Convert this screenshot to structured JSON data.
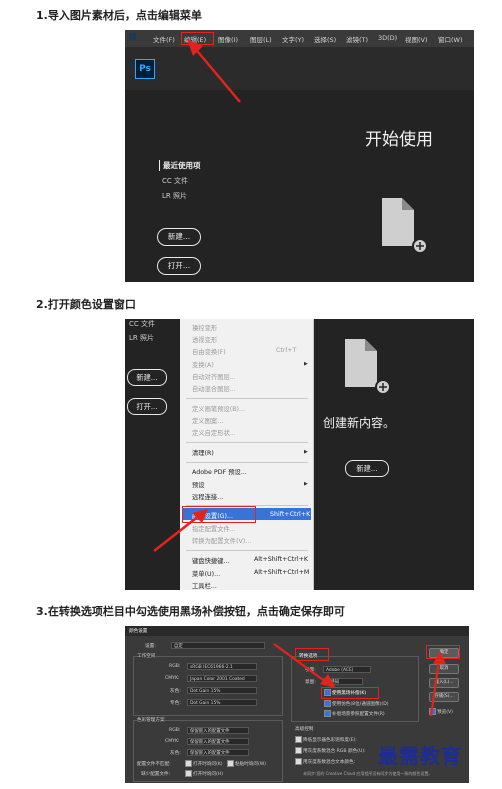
{
  "steps": [
    "1.导入图片素材后，点击编辑菜单",
    "2.打开颜色设置窗口",
    "3.在转换选项栏目中勾选使用黑场补偿按钮，点击确定保存即可"
  ],
  "shot1": {
    "menubar": [
      "文件(F)",
      "编辑(E)",
      "图像(I)",
      "图层(L)",
      "文字(Y)",
      "选择(S)",
      "滤镜(T)",
      "3D(D)",
      "视图(V)",
      "窗口(W)"
    ],
    "ps_logo": "Ps",
    "heading": "开始使用",
    "recent": "最近使用项",
    "sidebar": [
      "CC 文件",
      "LR 照片"
    ],
    "new_button": "新建...",
    "open_button": "打开..."
  },
  "shot2": {
    "sidebar": [
      "CC 文件",
      "LR 照片"
    ],
    "new_button": "新建...",
    "open_button": "打开...",
    "create_text": "创建新内容。",
    "create_button": "新建...",
    "menu_items": [
      {
        "label": "操控变形",
        "shortcut": "",
        "dim": true
      },
      {
        "label": "透视变形",
        "shortcut": "",
        "dim": true
      },
      {
        "label": "自由变换(F)",
        "shortcut": "Ctrl+T",
        "dim": true
      },
      {
        "label": "变换(A)",
        "shortcut": "",
        "dim": true,
        "submenu": true
      },
      {
        "label": "自动对齐图层...",
        "shortcut": "",
        "dim": true
      },
      {
        "label": "自动混合图层...",
        "shortcut": "",
        "dim": true
      },
      {
        "label": "定义画笔预设(B)...",
        "shortcut": "",
        "dim": true
      },
      {
        "label": "定义图案...",
        "shortcut": "",
        "dim": true
      },
      {
        "label": "定义自定形状...",
        "shortcut": "",
        "dim": true
      },
      {
        "label": "清理(R)",
        "shortcut": "",
        "dim": false,
        "submenu": true
      },
      {
        "label": "Adobe PDF 预设...",
        "shortcut": "",
        "dim": false
      },
      {
        "label": "预设",
        "shortcut": "",
        "dim": false,
        "submenu": true
      },
      {
        "label": "远程连接...",
        "shortcut": "",
        "dim": false
      },
      {
        "label": "颜色设置(G)...",
        "shortcut": "Shift+Ctrl+K",
        "dim": false,
        "highlighted": true
      },
      {
        "label": "指定配置文件...",
        "shortcut": "",
        "dim": true
      },
      {
        "label": "转换为配置文件(V)...",
        "shortcut": "",
        "dim": true
      },
      {
        "label": "键盘快捷键...",
        "shortcut": "Alt+Shift+Ctrl+K",
        "dim": false
      },
      {
        "label": "菜单(U)...",
        "shortcut": "Alt+Shift+Ctrl+M",
        "dim": false
      },
      {
        "label": "工具栏...",
        "shortcut": "",
        "dim": false
      }
    ]
  },
  "shot3": {
    "title": "颜色设置",
    "settings_label": "设置:",
    "settings_value": "自定",
    "working_spaces": "工作空间",
    "ws_rows": [
      {
        "label": "RGB:",
        "value": "sRGB IEC61966-2.1"
      },
      {
        "label": "CMYK:",
        "value": "Japan Color 2001 Coated"
      },
      {
        "label": "灰色:",
        "value": "Dot Gain 15%"
      },
      {
        "label": "专色:",
        "value": "Dot Gain 15%"
      }
    ],
    "color_management": "色彩管理方案",
    "cm_rows": [
      {
        "label": "RGB:",
        "value": "保留嵌入的配置文件"
      },
      {
        "label": "CMYK:",
        "value": "保留嵌入的配置文件"
      },
      {
        "label": "灰色:",
        "value": "保留嵌入的配置文件"
      }
    ],
    "conversion_options": "转换选项",
    "engine_label": "引擎:",
    "engine_value": "Adobe (ACE)",
    "intent_label": "意图:",
    "intent_value": "可感知",
    "black_point": "使用黑场补偿(K)",
    "dither": "使用仿色(8位/通道图像)(D)",
    "compensate": "补偿场景参照配置文件(R)",
    "advanced": "高级控制",
    "desaturate": "降低显示器色彩饱和度(E):",
    "blend_rgb": "用灰度系数混合 RGB 颜色(U):",
    "blend_text": "用灰度系数混合文本颜色:",
    "missing_profiles": "配置文件不匹配:",
    "missing_label": "缺少配置文件:",
    "ask_open": "打开时询问(K)",
    "ask_paste": "粘贴时询问(W)",
    "ask_open2": "打开时询问(H)",
    "ok_button": "确定",
    "cancel_button": "取消",
    "load_button": "载入(L)...",
    "save_button": "存储(S)...",
    "preview": "预览(V)",
    "info": "未同步:您的 Creative Cloud 应用程序没有同步为使用一致的颜色设置。"
  },
  "watermark": "最需教育",
  "colors": {
    "accent_red": "#e3231c",
    "ps_blue": "#31a8ff",
    "menu_highlight": "#3874d8"
  }
}
